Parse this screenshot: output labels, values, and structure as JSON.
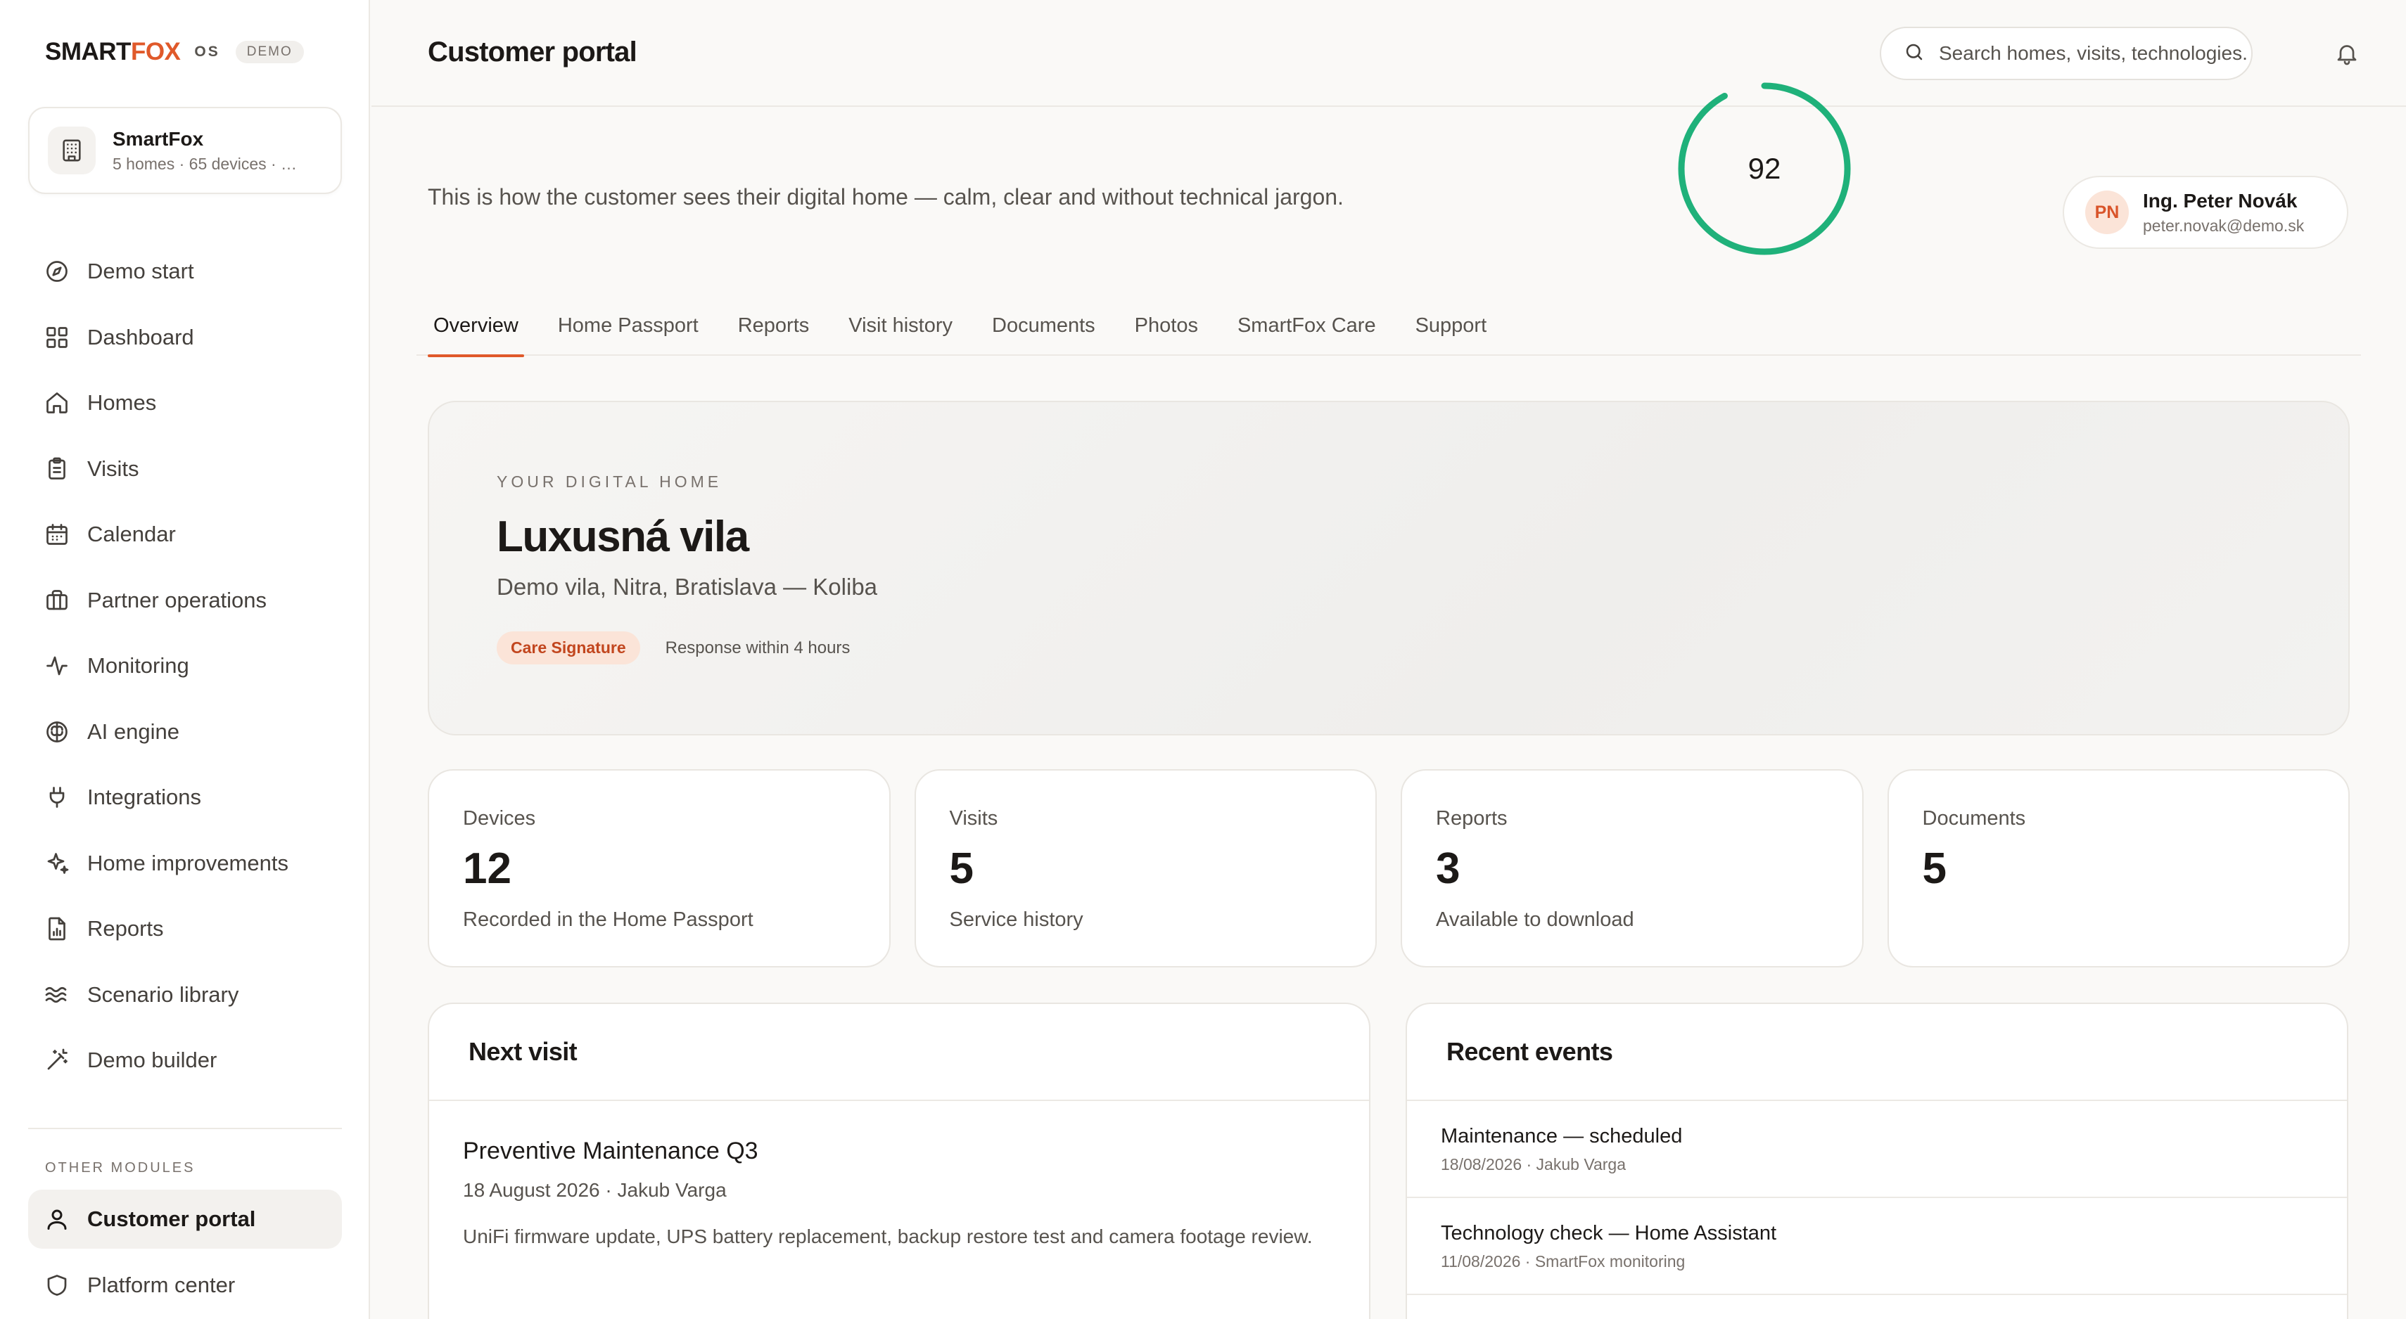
{
  "brand": {
    "name_main": "SMART",
    "name_accent": "FOX",
    "os": "OS",
    "badge": "DEMO",
    "accent_color": "#e0592a"
  },
  "org": {
    "name": "SmartFox",
    "summary": "5 homes · 65 devices · …",
    "icon": "building-icon"
  },
  "sidebar": {
    "items": [
      {
        "label": "Demo start",
        "icon": "compass-icon"
      },
      {
        "label": "Dashboard",
        "icon": "grid-icon"
      },
      {
        "label": "Homes",
        "icon": "home-icon"
      },
      {
        "label": "Visits",
        "icon": "clipboard-icon"
      },
      {
        "label": "Calendar",
        "icon": "calendar-icon"
      },
      {
        "label": "Partner operations",
        "icon": "briefcase-icon"
      },
      {
        "label": "Monitoring",
        "icon": "activity-icon"
      },
      {
        "label": "AI engine",
        "icon": "brain-icon"
      },
      {
        "label": "Integrations",
        "icon": "plug-icon"
      },
      {
        "label": "Home improvements",
        "icon": "sparkles-icon"
      },
      {
        "label": "Reports",
        "icon": "report-icon"
      },
      {
        "label": "Scenario library",
        "icon": "waves-icon"
      },
      {
        "label": "Demo builder",
        "icon": "wand-icon"
      }
    ],
    "other_label": "OTHER MODULES",
    "other_items": [
      {
        "label": "Customer portal",
        "icon": "user-icon",
        "active": true
      },
      {
        "label": "Platform center",
        "icon": "shield-icon"
      }
    ]
  },
  "header": {
    "title": "Customer portal",
    "search_placeholder": "Search homes, visits, technologies..."
  },
  "intro": "This is how the customer sees their digital home — calm, clear and without technical jargon.",
  "user": {
    "initials": "PN",
    "name": "Ing. Peter Novák",
    "email": "peter.novak@demo.sk"
  },
  "tabs": [
    "Overview",
    "Home Passport",
    "Reports",
    "Visit history",
    "Documents",
    "Photos",
    "SmartFox Care",
    "Support"
  ],
  "active_tab": "Overview",
  "hero": {
    "kicker": "YOUR DIGITAL HOME",
    "title": "Luxusná vila",
    "address": "Demo vila, Nitra, Bratislava — Koliba",
    "badge": "Care Signature",
    "response": "Response within 4 hours",
    "score": "92",
    "score_fraction": 0.92,
    "score_color": "#1fb17a"
  },
  "stats": [
    {
      "label": "Devices",
      "value": "12",
      "sub": "Recorded in the Home Passport"
    },
    {
      "label": "Visits",
      "value": "5",
      "sub": "Service history"
    },
    {
      "label": "Reports",
      "value": "3",
      "sub": "Available to download"
    },
    {
      "label": "Documents",
      "value": "5",
      "sub": ""
    }
  ],
  "next_visit": {
    "heading": "Next visit",
    "title": "Preventive Maintenance Q3",
    "meta": "18 August 2026 · Jakub Varga",
    "description": "UniFi firmware update, UPS battery replacement, backup restore test and camera footage review."
  },
  "recent_events": {
    "heading": "Recent events",
    "items": [
      {
        "title": "Maintenance — scheduled",
        "meta": "18/08/2026 · Jakub Varga"
      },
      {
        "title": "Technology check — Home Assistant",
        "meta": "11/08/2026 · SmartFox monitoring"
      }
    ]
  }
}
